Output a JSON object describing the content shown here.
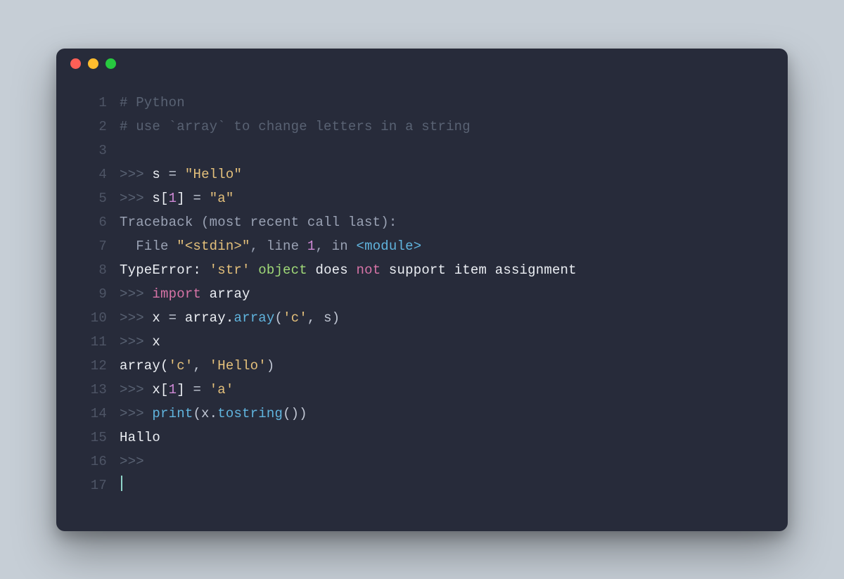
{
  "window": {
    "traffic_light_labels": {
      "close": "close",
      "minimize": "minimize",
      "zoom": "zoom"
    }
  },
  "code": {
    "lines": [
      {
        "n": "1",
        "tokens": [
          {
            "text": "# Python",
            "cls": "tok-comment"
          }
        ]
      },
      {
        "n": "2",
        "tokens": [
          {
            "text": "# use `array` to change letters in a string",
            "cls": "tok-comment"
          }
        ]
      },
      {
        "n": "3",
        "tokens": [
          {
            "text": "",
            "cls": "tok-ident"
          }
        ]
      },
      {
        "n": "4",
        "tokens": [
          {
            "text": ">>> ",
            "cls": "tok-prompt"
          },
          {
            "text": "s ",
            "cls": "tok-ident"
          },
          {
            "text": "= ",
            "cls": "tok-punct"
          },
          {
            "text": "\"Hello\"",
            "cls": "tok-string"
          }
        ]
      },
      {
        "n": "5",
        "tokens": [
          {
            "text": ">>> ",
            "cls": "tok-prompt"
          },
          {
            "text": "s[",
            "cls": "tok-ident"
          },
          {
            "text": "1",
            "cls": "tok-number"
          },
          {
            "text": "] ",
            "cls": "tok-ident"
          },
          {
            "text": "= ",
            "cls": "tok-punct"
          },
          {
            "text": "\"a\"",
            "cls": "tok-string"
          }
        ]
      },
      {
        "n": "6",
        "tokens": [
          {
            "text": "Traceback (most recent call last):",
            "cls": "tok-dim"
          }
        ]
      },
      {
        "n": "7",
        "tokens": [
          {
            "text": "  File ",
            "cls": "tok-dim"
          },
          {
            "text": "\"<stdin>\"",
            "cls": "tok-string"
          },
          {
            "text": ", line ",
            "cls": "tok-dim"
          },
          {
            "text": "1",
            "cls": "tok-number"
          },
          {
            "text": ", in ",
            "cls": "tok-dim"
          },
          {
            "text": "<module>",
            "cls": "tok-func"
          }
        ]
      },
      {
        "n": "8",
        "tokens": [
          {
            "text": "TypeError: ",
            "cls": "tok-ident"
          },
          {
            "text": "'str'",
            "cls": "tok-string"
          },
          {
            "text": " ",
            "cls": "tok-ident"
          },
          {
            "text": "object",
            "cls": "tok-builtin"
          },
          {
            "text": " does ",
            "cls": "tok-ident"
          },
          {
            "text": "not",
            "cls": "tok-keyword"
          },
          {
            "text": " support item assignment",
            "cls": "tok-ident"
          }
        ]
      },
      {
        "n": "9",
        "tokens": [
          {
            "text": ">>> ",
            "cls": "tok-prompt"
          },
          {
            "text": "import",
            "cls": "tok-keyword"
          },
          {
            "text": " array",
            "cls": "tok-ident"
          }
        ]
      },
      {
        "n": "10",
        "tokens": [
          {
            "text": ">>> ",
            "cls": "tok-prompt"
          },
          {
            "text": "x ",
            "cls": "tok-ident"
          },
          {
            "text": "= ",
            "cls": "tok-punct"
          },
          {
            "text": "array.",
            "cls": "tok-ident"
          },
          {
            "text": "array",
            "cls": "tok-func"
          },
          {
            "text": "(",
            "cls": "tok-punct"
          },
          {
            "text": "'c'",
            "cls": "tok-string"
          },
          {
            "text": ", s)",
            "cls": "tok-punct"
          }
        ]
      },
      {
        "n": "11",
        "tokens": [
          {
            "text": ">>> ",
            "cls": "tok-prompt"
          },
          {
            "text": "x",
            "cls": "tok-ident"
          }
        ]
      },
      {
        "n": "12",
        "tokens": [
          {
            "text": "array(",
            "cls": "tok-ident"
          },
          {
            "text": "'c'",
            "cls": "tok-string"
          },
          {
            "text": ", ",
            "cls": "tok-punct"
          },
          {
            "text": "'Hello'",
            "cls": "tok-string"
          },
          {
            "text": ")",
            "cls": "tok-punct"
          }
        ]
      },
      {
        "n": "13",
        "tokens": [
          {
            "text": ">>> ",
            "cls": "tok-prompt"
          },
          {
            "text": "x[",
            "cls": "tok-ident"
          },
          {
            "text": "1",
            "cls": "tok-number"
          },
          {
            "text": "] ",
            "cls": "tok-ident"
          },
          {
            "text": "= ",
            "cls": "tok-punct"
          },
          {
            "text": "'a'",
            "cls": "tok-string"
          }
        ]
      },
      {
        "n": "14",
        "tokens": [
          {
            "text": ">>> ",
            "cls": "tok-prompt"
          },
          {
            "text": "print",
            "cls": "tok-func"
          },
          {
            "text": "(x.",
            "cls": "tok-punct"
          },
          {
            "text": "tostring",
            "cls": "tok-func"
          },
          {
            "text": "())",
            "cls": "tok-punct"
          }
        ]
      },
      {
        "n": "15",
        "tokens": [
          {
            "text": "Hallo",
            "cls": "tok-ident"
          }
        ]
      },
      {
        "n": "16",
        "tokens": [
          {
            "text": ">>>",
            "cls": "tok-prompt"
          }
        ]
      },
      {
        "n": "17",
        "tokens": [
          {
            "text": "",
            "cls": "tok-ident"
          }
        ],
        "cursor": true
      }
    ]
  }
}
